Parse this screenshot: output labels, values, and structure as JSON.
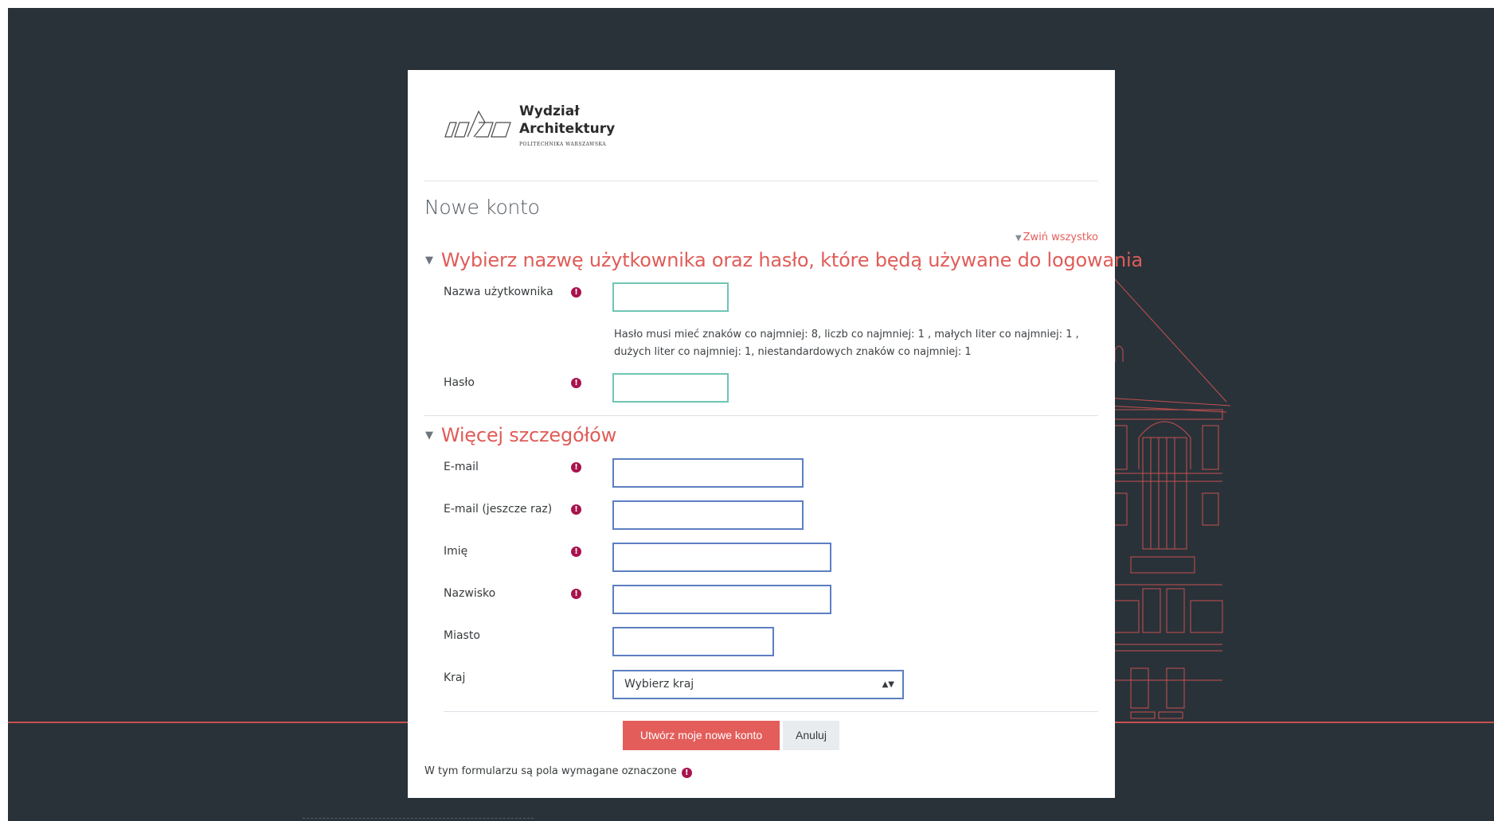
{
  "logo": {
    "line1": "Wydział",
    "line2": "Architektury",
    "subtitle": "POLITECHNIKA WARSZAWSKA"
  },
  "page": {
    "title": "Nowe konto",
    "collapse_all": "Zwiń wszystko"
  },
  "section_login": {
    "heading": "Wybierz nazwę użytkownika oraz hasło, które będą używane do logowania",
    "username_label": "Nazwa użytkownika",
    "password_help": "Hasło musi mieć znaków co najmniej: 8, liczb co najmniej: 1 , małych liter co najmniej: 1 , dużych liter co najmniej: 1, niestandardowych znaków co najmniej: 1",
    "password_label": "Hasło"
  },
  "section_details": {
    "heading": "Więcej szczegółów",
    "email_label": "E-mail",
    "email2_label": "E-mail (jeszcze raz)",
    "firstname_label": "Imię",
    "lastname_label": "Nazwisko",
    "city_label": "Miasto",
    "country_label": "Kraj",
    "country_selected": "Wybierz kraj"
  },
  "buttons": {
    "submit": "Utwórz moje nowe konto",
    "cancel": "Anuluj"
  },
  "footer_note": "W tym formularzu są pola wymagane oznaczone",
  "icons": {
    "required": "exclamation-circle-icon",
    "collapse": "caret-down-icon",
    "select_arrows": "sort-icon"
  },
  "colors": {
    "background": "#293239",
    "accent": "#e35d5b",
    "required": "#a8134e",
    "input_border": "#5c7fc2",
    "input_border_focus": "#70c5b4"
  }
}
